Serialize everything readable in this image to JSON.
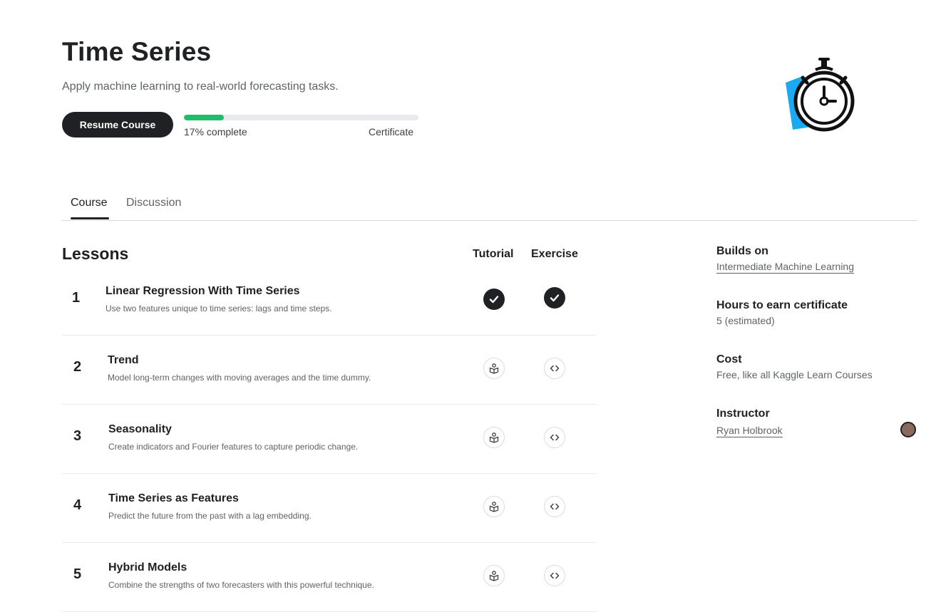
{
  "course": {
    "title": "Time Series",
    "subtitle": "Apply machine learning to real-world forecasting tasks.",
    "resume_label": "Resume Course",
    "progress_percent": 17,
    "progress_label": "17% complete",
    "certificate_label": "Certificate",
    "icon": "stopwatch-icon",
    "colors": {
      "accent": "#20be6c",
      "icon_blue": "#1aaaf2",
      "dark": "#202124"
    }
  },
  "tabs": [
    {
      "label": "Course",
      "active": true
    },
    {
      "label": "Discussion",
      "active": false
    }
  ],
  "lessons": {
    "heading": "Lessons",
    "tutorial_header": "Tutorial",
    "exercise_header": "Exercise",
    "items": [
      {
        "number": "1",
        "title": "Linear Regression With Time Series",
        "description": "Use two features unique to time series: lags and time steps.",
        "tutorial_done": true,
        "exercise_done": true
      },
      {
        "number": "2",
        "title": "Trend",
        "description": "Model long-term changes with moving averages and the time dummy.",
        "tutorial_done": false,
        "exercise_done": false
      },
      {
        "number": "3",
        "title": "Seasonality",
        "description": "Create indicators and Fourier features to capture periodic change.",
        "tutorial_done": false,
        "exercise_done": false
      },
      {
        "number": "4",
        "title": "Time Series as Features",
        "description": "Predict the future from the past with a lag embedding.",
        "tutorial_done": false,
        "exercise_done": false
      },
      {
        "number": "5",
        "title": "Hybrid Models",
        "description": "Combine the strengths of two forecasters with this powerful technique.",
        "tutorial_done": false,
        "exercise_done": false
      }
    ]
  },
  "sidebar": {
    "builds_on_label": "Builds on",
    "builds_on_value": "Intermediate Machine Learning",
    "hours_label": "Hours to earn certificate",
    "hours_value": "5 (estimated)",
    "cost_label": "Cost",
    "cost_value": "Free, like all Kaggle Learn Courses",
    "instructor_label": "Instructor",
    "instructor_value": "Ryan Holbrook"
  }
}
